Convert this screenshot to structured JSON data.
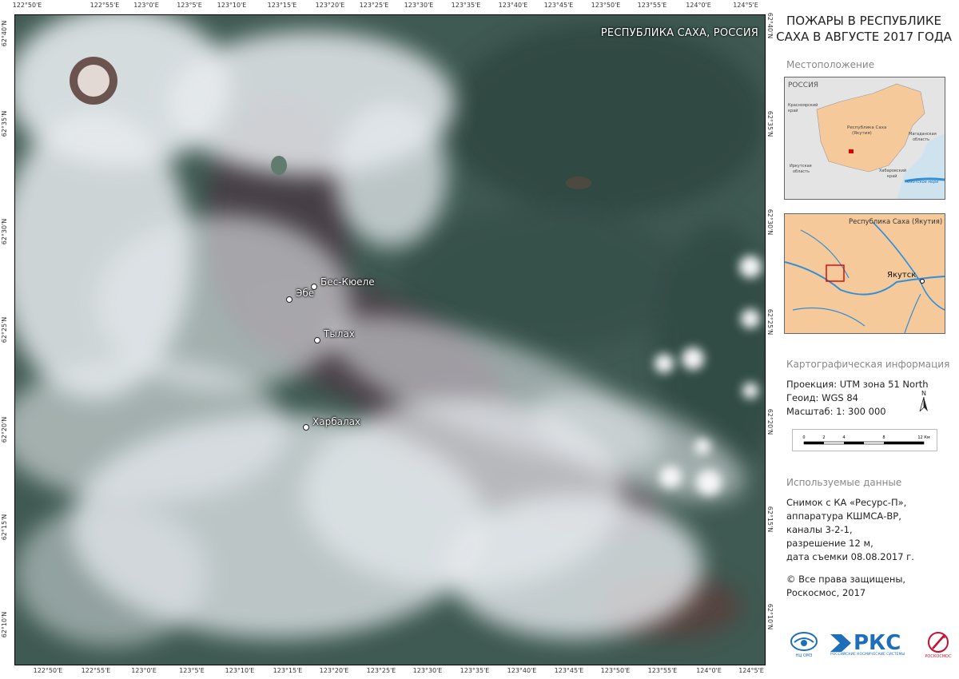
{
  "map": {
    "region_label": "РЕСПУБЛИКА САХА, РОССИЯ",
    "top_coords": [
      "122°50'E",
      "122°55'E",
      "123°0'E",
      "123°5'E",
      "123°10'E",
      "123°15'E",
      "123°20'E",
      "123°25'E",
      "123°30'E",
      "123°35'E",
      "123°40'E",
      "123°45'E",
      "123°50'E",
      "123°55'E",
      "124°0'E",
      "124°5'E"
    ],
    "bottom_coords": [
      "122°50'E",
      "122°55'E",
      "123°0'E",
      "123°5'E",
      "123°10'E",
      "123°15'E",
      "123°20'E",
      "123°25'E",
      "123°30'E",
      "123°35'E",
      "123°40'E",
      "123°45'E",
      "123°50'E",
      "123°55'E",
      "124°0'E",
      "124°5'E"
    ],
    "lat_coords": [
      "62°40'N",
      "62°35'N",
      "62°30'N",
      "62°25'N",
      "62°20'N",
      "62°15'N",
      "62°10'N"
    ],
    "settlements": {
      "bes_kuele": "Бес-Кюеле",
      "ebe": "Эбе",
      "tylakh": "Тылах",
      "kharbalakh": "Харбалах"
    }
  },
  "panel": {
    "title_line1": "ПОЖАРЫ В РЕСПУБЛИКЕ",
    "title_line2": "САХА В АВГУСТЕ 2017 ГОДА",
    "location_heading": "Местоположение",
    "inset1": {
      "country": "РОССИЯ",
      "region": "Республика Саха",
      "region2": "(Якутия)",
      "krasnoyarsk": "Красноярский",
      "krasnoyarsk2": "край",
      "magadan": "Магаданская",
      "magadan2": "область",
      "irkutsk": "Иркутская",
      "irkutsk2": "область",
      "khabarovsk": "Хабаровский",
      "khabarovsk2": "край",
      "sea": "Охотское море"
    },
    "inset2": {
      "region": "Республика Саха (Якутия)",
      "city": "Якутск"
    },
    "carto_heading": "Картографическая информация",
    "projection": "Проекция: UTM зона 51 North",
    "geoid": "Геоид: WGS 84",
    "scale": "Масштаб: 1: 300 000",
    "north": "N",
    "scale_ticks": [
      "0",
      "2",
      "4",
      "8",
      "12 Км"
    ],
    "data_heading": "Используемые данные",
    "data_lines": [
      "Снимок с КА «Ресурс-П»,",
      "аппаратура КШМСА-ВР,",
      "каналы 3-2-1,",
      "разрешение 12 м,",
      "дата съемки 08.08.2017 г."
    ],
    "copyright1": "© Все права защищены,",
    "copyright2": "Роскосмос, 2017",
    "logo_left_caption": "НЦ ОМЗ",
    "logo_mid_text": "РКС",
    "logo_mid_caption": "РОССИЙСКИЕ КОСМИЧЕСКИЕ СИСТЕМЫ",
    "logo_right_caption": "РОСКОСМОС"
  },
  "colors": {
    "land_dark": "#3f5a52",
    "smoke": "#e8ecef",
    "burned": "#4a3a44",
    "inset_land": "#f6c99a",
    "inset_water": "#2f8fd8"
  }
}
